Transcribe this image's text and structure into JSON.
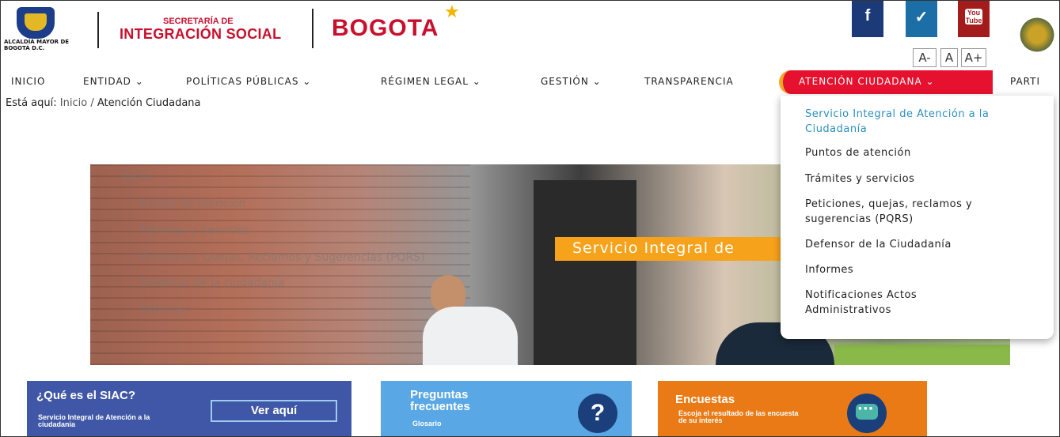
{
  "header": {
    "alcaldia": "ALCALDÍA MAYOR DE BOGOTÁ D.C.",
    "secretaria_top": "SECRETARÍA DE",
    "secretaria_main": "INTEGRACIÓN SOCIAL",
    "bogota": "BOGOTA",
    "social": {
      "facebook": "f",
      "twitter": "✓",
      "youtube": "You Tube"
    },
    "font_controls": [
      "A-",
      "A",
      "A+"
    ]
  },
  "nav": {
    "items": [
      "INICIO",
      "ENTIDAD ⌄",
      "POLÍTICAS PÚBLICAS ⌄",
      "RÉGIMEN LEGAL ⌄",
      "GESTIÓN ⌄",
      "TRANSPARENCIA",
      "ATENCIÓN CIUDADANA ⌄",
      "PARTI"
    ],
    "active_index": 6
  },
  "breadcrumb": {
    "prefix": "Está aquí:",
    "items": [
      "Inicio",
      "/",
      "Atención Ciudadana"
    ]
  },
  "hero": {
    "banner": "Servicio Integral de",
    "ghost_menu": [
      "Inicio",
      "Puntos de atención",
      "Trámites y Servicios",
      "Peticiones, Quejas, Reclamos y Sugerencias (PQRS)",
      "Defensor de la ciudadanía",
      "Informes"
    ]
  },
  "dropdown": {
    "items": [
      "Servicio Integral de Atención a la Ciudadanía",
      "Puntos de atención",
      "Trámites y servicios",
      "Peticiones, quejas, reclamos y sugerencias (PQRS)",
      "Defensor de la Ciudadanía",
      "Informes",
      "Notificaciones Actos Administrativos"
    ]
  },
  "cards": {
    "siac": {
      "title": "¿Qué es el SIAC?",
      "subtitle": "Servicio Integral de Atención a la ciudadania",
      "button": "Ver aquí"
    },
    "faq": {
      "title": "Preguntas frecuentes",
      "subtitle": "Glosario"
    },
    "survey": {
      "title": "Encuestas",
      "subtitle": "Escoja el resultado de las encuesta de su interés"
    }
  },
  "colors": {
    "brand_red": "#e6112e",
    "accent_orange": "#f7a21b",
    "link_blue": "#2b8fbd",
    "card_blue": "#3f57a6",
    "card_light_blue": "#5aa7e6",
    "card_orange": "#ea7a16"
  }
}
